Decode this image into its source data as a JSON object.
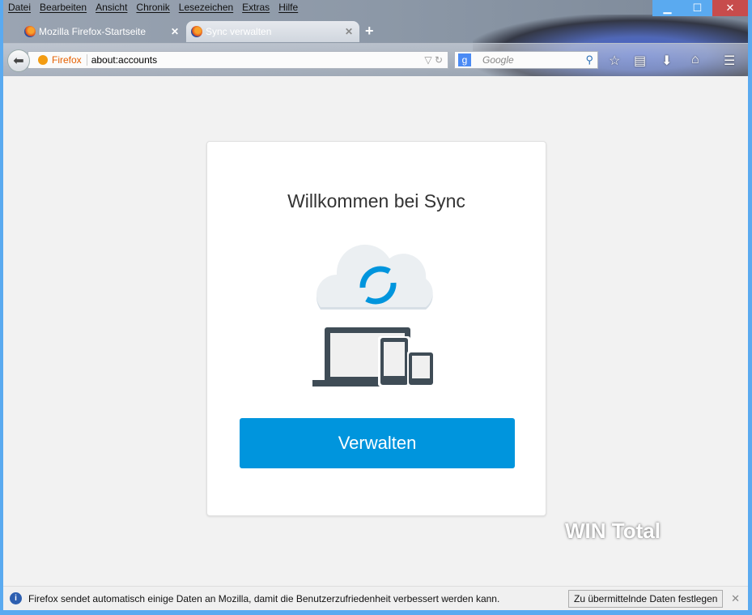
{
  "menu": [
    "Datei",
    "Bearbeiten",
    "Ansicht",
    "Chronik",
    "Lesezeichen",
    "Extras",
    "Hilfe"
  ],
  "window_buttons": {
    "minimize": "▁",
    "maximize": "☐",
    "close": "✕"
  },
  "tabs": [
    {
      "label": "Mozilla Firefox-Startseite",
      "active": false
    },
    {
      "label": "Sync verwalten",
      "active": true
    }
  ],
  "new_tab": "+",
  "urlbar": {
    "identity": "Firefox",
    "url": "about:accounts"
  },
  "search": {
    "placeholder": "Google",
    "engine": "g"
  },
  "content": {
    "title": "Willkommen bei Sync",
    "button": "Verwalten",
    "accent": "#0095dd"
  },
  "watermark": "WIN Total",
  "infobar": {
    "message": "Firefox sendet automatisch einige Daten an Mozilla, damit die Benutzerzufriedenheit verbessert werden kann.",
    "button": "Zu übermittelnde Daten festlegen"
  }
}
